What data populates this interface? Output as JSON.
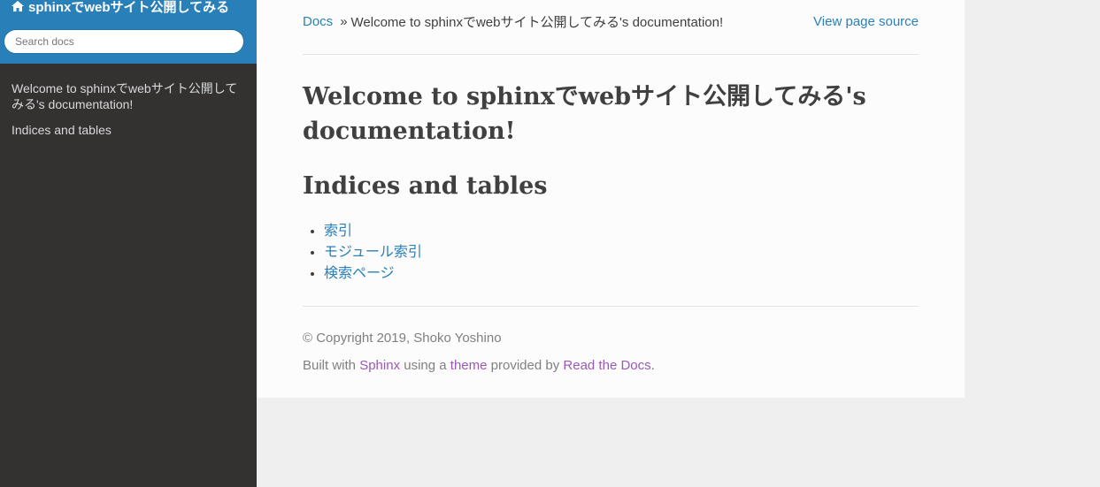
{
  "sidebar": {
    "project_title": "sphinxでwebサイト公開してみる",
    "search_placeholder": "Search docs",
    "nav": [
      {
        "label": "Welcome to sphinxでwebサイト公開してみる's documentation!"
      },
      {
        "label": "Indices and tables"
      }
    ]
  },
  "breadcrumbs": {
    "home": "Docs",
    "separator": "»",
    "current": "Welcome to sphinxでwebサイト公開してみる's documentation!",
    "view_source": "View page source"
  },
  "main": {
    "title": "Welcome to sphinxでwebサイト公開してみる's documentation!",
    "section_title": "Indices and tables",
    "links": [
      {
        "label": "索引"
      },
      {
        "label": "モジュール索引"
      },
      {
        "label": "検索ページ"
      }
    ]
  },
  "footer": {
    "copyright": "© Copyright 2019, Shoko Yoshino",
    "built_prefix": "Built with",
    "sphinx": "Sphinx",
    "using_a": "using a",
    "theme": "theme",
    "provided_by": "provided by",
    "rtd": "Read the Docs."
  },
  "colors": {
    "sidebar_header": "#2980b9",
    "sidebar_bg": "#343131",
    "link": "#2980b9",
    "footer_link": "#9b59b6"
  }
}
